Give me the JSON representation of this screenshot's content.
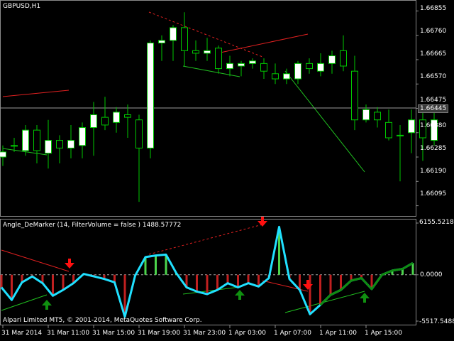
{
  "main_chart": {
    "symbol_label": "GBPUSD,H1",
    "price_levels": [
      "1.66855",
      "1.66760",
      "1.66665",
      "1.66570",
      "1.66475",
      "1.66380",
      "1.66285",
      "1.66190",
      "1.66095"
    ],
    "current_price": "1.66445"
  },
  "indicator": {
    "label": "Angle_DeMarker (14, FilterVolume = false ) 1488.57772",
    "levels": [
      "6155.52186",
      "0.0000",
      "-5517.54883"
    ],
    "broker_notice": "Alpari Limited MT5, © 2001-2014, MetaQuotes Software Corp."
  },
  "time_axis": {
    "labels": [
      "31 Mar 2014",
      "31 Mar 11:00",
      "31 Mar 15:00",
      "31 Mar 19:00",
      "31 Mar 23:00",
      "1 Apr 03:00",
      "1 Apr 07:00",
      "1 Apr 11:00",
      "1 Apr 15:00"
    ]
  },
  "colors": {
    "background": "#000000",
    "bull_candle": "#ffffff",
    "bear_candle": "#000000",
    "wick": "#00c800",
    "indicator_line": "#20e0ff",
    "positive_bar": "#4cd44c",
    "negative_bar": "#c02020",
    "up_arrow": "#109010",
    "down_arrow": "#ff1010",
    "trend_red": "#e02020",
    "trend_green": "#20c020"
  },
  "chart_data": {
    "type": "candlestick",
    "candles": [
      {
        "o": 1.66285,
        "h": 1.6633,
        "l": 1.6625,
        "c": 1.66305
      },
      {
        "o": 1.6633,
        "h": 1.6636,
        "l": 1.66305,
        "c": 1.6633
      },
      {
        "o": 1.6631,
        "h": 1.6641,
        "l": 1.6629,
        "c": 1.6639
      },
      {
        "o": 1.6639,
        "h": 1.6641,
        "l": 1.6626,
        "c": 1.6631
      },
      {
        "o": 1.663,
        "h": 1.6643,
        "l": 1.6624,
        "c": 1.6635
      },
      {
        "o": 1.6635,
        "h": 1.6637,
        "l": 1.6626,
        "c": 1.6632
      },
      {
        "o": 1.6632,
        "h": 1.6641,
        "l": 1.6628,
        "c": 1.6635
      },
      {
        "o": 1.6633,
        "h": 1.6642,
        "l": 1.6628,
        "c": 1.664
      },
      {
        "o": 1.664,
        "h": 1.665,
        "l": 1.6629,
        "c": 1.6645
      },
      {
        "o": 1.6644,
        "h": 1.6652,
        "l": 1.6639,
        "c": 1.6641
      },
      {
        "o": 1.6642,
        "h": 1.6648,
        "l": 1.6638,
        "c": 1.6646
      },
      {
        "o": 1.6645,
        "h": 1.6649,
        "l": 1.6636,
        "c": 1.6644
      },
      {
        "o": 1.6643,
        "h": 1.6645,
        "l": 1.6611,
        "c": 1.6632
      },
      {
        "o": 1.6632,
        "h": 1.6674,
        "l": 1.6628,
        "c": 1.6673
      },
      {
        "o": 1.6673,
        "h": 1.6676,
        "l": 1.6666,
        "c": 1.6674
      },
      {
        "o": 1.6674,
        "h": 1.668,
        "l": 1.6666,
        "c": 1.6679
      },
      {
        "o": 1.6679,
        "h": 1.6685,
        "l": 1.6664,
        "c": 1.667
      },
      {
        "o": 1.667,
        "h": 1.6674,
        "l": 1.6666,
        "c": 1.6669
      },
      {
        "o": 1.6669,
        "h": 1.6675,
        "l": 1.6666,
        "c": 1.667
      },
      {
        "o": 1.6671,
        "h": 1.6672,
        "l": 1.6661,
        "c": 1.6663
      },
      {
        "o": 1.6663,
        "h": 1.6668,
        "l": 1.666,
        "c": 1.6665
      },
      {
        "o": 1.6664,
        "h": 1.6666,
        "l": 1.666,
        "c": 1.6665
      },
      {
        "o": 1.6665,
        "h": 1.6667,
        "l": 1.6663,
        "c": 1.6666
      },
      {
        "o": 1.6665,
        "h": 1.6667,
        "l": 1.6659,
        "c": 1.6662
      },
      {
        "o": 1.6661,
        "h": 1.6665,
        "l": 1.6657,
        "c": 1.6659
      },
      {
        "o": 1.6659,
        "h": 1.6663,
        "l": 1.6657,
        "c": 1.6661
      },
      {
        "o": 1.6659,
        "h": 1.6666,
        "l": 1.6657,
        "c": 1.6665
      },
      {
        "o": 1.6665,
        "h": 1.6667,
        "l": 1.6661,
        "c": 1.6663
      },
      {
        "o": 1.6662,
        "h": 1.6669,
        "l": 1.666,
        "c": 1.6665
      },
      {
        "o": 1.6665,
        "h": 1.667,
        "l": 1.6661,
        "c": 1.6668
      },
      {
        "o": 1.667,
        "h": 1.6676,
        "l": 1.6662,
        "c": 1.6664
      },
      {
        "o": 1.6662,
        "h": 1.6668,
        "l": 1.6639,
        "c": 1.6643
      },
      {
        "o": 1.6643,
        "h": 1.6649,
        "l": 1.6642,
        "c": 1.6647
      },
      {
        "o": 1.6646,
        "h": 1.6648,
        "l": 1.664,
        "c": 1.6643
      },
      {
        "o": 1.6642,
        "h": 1.6647,
        "l": 1.6635,
        "c": 1.6636
      },
      {
        "o": 1.6637,
        "h": 1.6641,
        "l": 1.6619,
        "c": 1.6637
      },
      {
        "o": 1.6638,
        "h": 1.6647,
        "l": 1.663,
        "c": 1.6643
      },
      {
        "o": 1.6643,
        "h": 1.6648,
        "l": 1.6627,
        "c": 1.6636
      },
      {
        "o": 1.6635,
        "h": 1.6649,
        "l": 1.6633,
        "c": 1.6643
      }
    ],
    "indicator_values": [
      -1500,
      -3000,
      -900,
      -200,
      -1000,
      -2500,
      -1800,
      -1000,
      100,
      -200,
      -500,
      -900,
      -5000,
      -100,
      2100,
      2300,
      2400,
      200,
      -1500,
      -2000,
      -2300,
      -1800,
      -1000,
      -1500,
      -1000,
      -1400,
      -400,
      5700,
      -500,
      -1800,
      -4700,
      -3600,
      -2400,
      -1800,
      -700,
      -400,
      -1700,
      0,
      500,
      700,
      1400
    ],
    "ylim_main": [
      1.66055,
      1.66895
    ],
    "ylim_indicator": [
      -5517.54883,
      6155.52186
    ]
  }
}
